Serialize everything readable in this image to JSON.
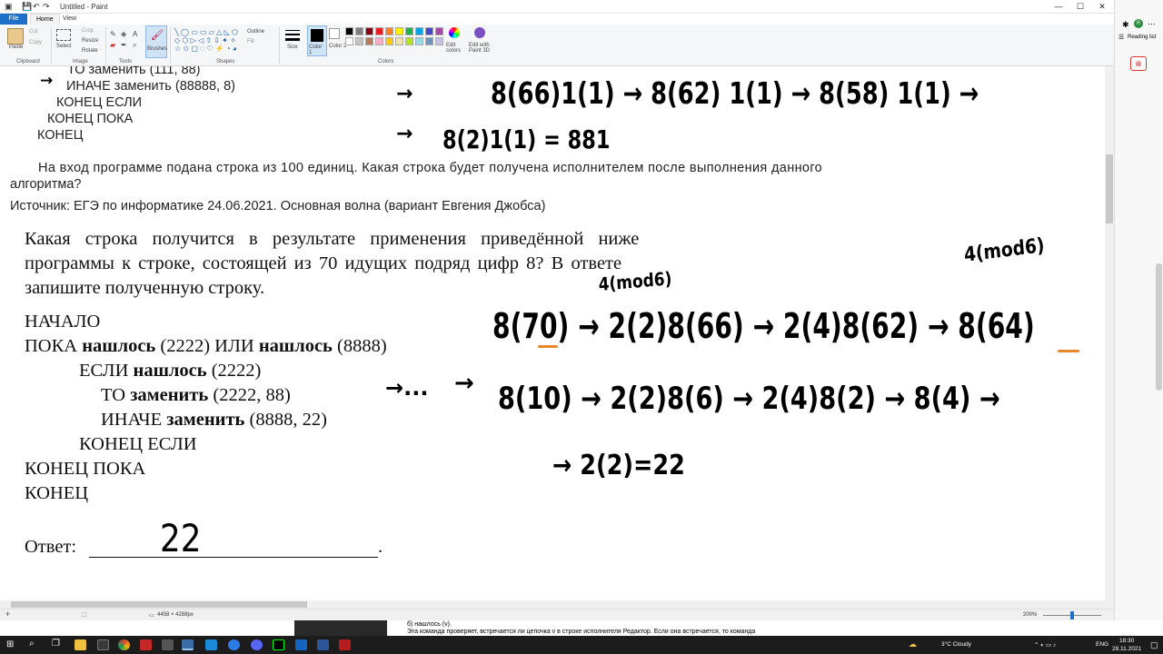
{
  "window": {
    "title": "Untitled - Paint",
    "minimize": "—",
    "maximize": "☐",
    "close": "✕"
  },
  "menu": {
    "file": "File",
    "home": "Home",
    "view": "View"
  },
  "ribbon": {
    "clipboard": {
      "paste": "Paste",
      "cut": "Cut",
      "copy": "Copy",
      "label": "Clipboard"
    },
    "image": {
      "select": "Select",
      "crop": "Crop",
      "resize": "Resize",
      "rotate": "Rotate",
      "label": "Image"
    },
    "tools": {
      "brushes": "Brushes",
      "label": "Tools"
    },
    "shapes": {
      "outline": "Outline",
      "fill": "Fill",
      "label": "Shapes"
    },
    "size": "Size",
    "color1": "Color 1",
    "color2": "Color 2",
    "colors_label": "Colors",
    "edit_colors": "Edit colors",
    "edit_paint3d": "Edit with Paint 3D",
    "palette": [
      "#000000",
      "#7f7f7f",
      "#880015",
      "#ed1c24",
      "#ff7f27",
      "#fff200",
      "#22b14c",
      "#00a2e8",
      "#3f48cc",
      "#a349a4",
      "#ffffff",
      "#c3c3c3",
      "#b97a57",
      "#ffaec9",
      "#ffc90e",
      "#efe4b0",
      "#b5e61d",
      "#99d9ea",
      "#7092be",
      "#c8bfe7"
    ]
  },
  "doc_top": {
    "l1": "ТО заменить (111, 88)",
    "l2": "ИНАЧЕ заменить (88888, 8)",
    "l3": "КОНЕЦ ЕСЛИ",
    "l4": "КОНЕЦ ПОКА",
    "l5": "КОНЕЦ",
    "p1": "На вход программе подана строка из 100 единиц. Какая строка будет получена исполнителем после выполнения данного",
    "p2": "алгоритма?",
    "source": "Источник: ЕГЭ по информатике 24.06.2021. Основная волна (вариант Евгения Джобса)"
  },
  "doc_main": {
    "q1": "Какая строка получится в результате применения приведённой ниже",
    "q2": "программы к строке, состоящей из 70 идущих подряд цифр 8? В ответе",
    "q3": "запишите полученную строку.",
    "c1": "НАЧАЛО",
    "c2a": "ПОКА ",
    "c2b": "нашлось",
    "c2c": " (2222) ИЛИ ",
    "c2d": "нашлось",
    "c2e": " (8888)",
    "c3a": "ЕСЛИ ",
    "c3b": "нашлось",
    "c3c": " (2222)",
    "c4a": "ТО ",
    "c4b": "заменить",
    "c4c": " (2222, 88)",
    "c5a": "ИНАЧЕ ",
    "c5b": "заменить",
    "c5c": " (8888, 22)",
    "c6": "КОНЕЦ ЕСЛИ",
    "c7": "КОНЕЦ ПОКА",
    "c8": "КОНЕЦ",
    "answer_label": "Ответ:",
    "answer_end": "."
  },
  "handwriting": {
    "top_row1": "8(66)1(1) → 8(62) 1(1) → 8(58) 1(1) →",
    "top_row2": "8(2)1(1) = 881",
    "note1": "4(mod6)",
    "note2": "4(mod6)",
    "row1a": "8(70) → 2(2)8(66) → 2(4)8(62) → 8(64)",
    "row2a": "8(10) → 2(2)8(6) → 2(4)8(2) → 8(4) →",
    "row3": "→ 2(2)=22",
    "answer": "22",
    "arrow_dots": "→...",
    "arrow": "→"
  },
  "status": {
    "dimensions": "4458 × 4288px",
    "zoom": "200%"
  },
  "browser_panel": {
    "reading_list": "Reading list"
  },
  "bottom_text": {
    "line1": "б) нашлось (v).",
    "line2": "Эта команда проверяет, встречается ли цепочка v в строке исполнителя Редактор. Если она встречается, то команда"
  },
  "taskbar": {
    "weather": "3°C  Cloudy",
    "lang": "ENG",
    "time": "18:30",
    "date": "28.11.2021"
  }
}
